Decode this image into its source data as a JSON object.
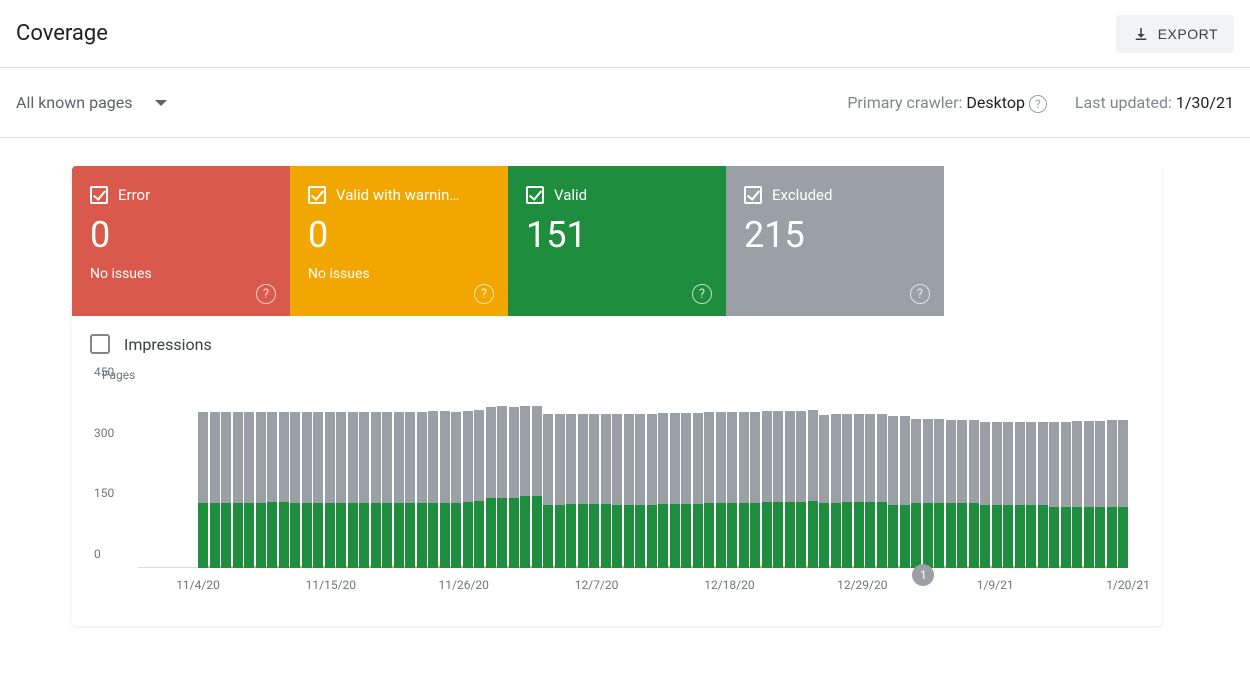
{
  "header": {
    "title": "Coverage",
    "export_label": "EXPORT"
  },
  "filter": {
    "label": "All known pages"
  },
  "meta": {
    "crawler_label": "Primary crawler:",
    "crawler_value": "Desktop",
    "updated_label": "Last updated:",
    "updated_value": "1/30/21"
  },
  "stats": {
    "error": {
      "label": "Error",
      "value": "0",
      "sub": "No issues"
    },
    "warning": {
      "label": "Valid with warnin…",
      "value": "0",
      "sub": "No issues"
    },
    "valid": {
      "label": "Valid",
      "value": "151",
      "sub": ""
    },
    "excluded": {
      "label": "Excluded",
      "value": "215",
      "sub": ""
    }
  },
  "impressions": {
    "label": "Impressions"
  },
  "chart_data": {
    "type": "bar",
    "title": "",
    "ylabel": "Pages",
    "xlabel": "",
    "ylim": [
      0,
      450
    ],
    "yticks": [
      0,
      150,
      300,
      450
    ],
    "categories": [
      "11/4/20",
      "11/15/20",
      "11/26/20",
      "12/7/20",
      "12/18/20",
      "12/29/20",
      "1/9/21",
      "1/20/21"
    ],
    "marker": {
      "label": "1",
      "x_fraction": 0.78
    },
    "series": [
      {
        "name": "Excluded",
        "color": "#9aa0a6",
        "values": [
          225,
          225,
          225,
          225,
          225,
          225,
          223,
          223,
          225,
          225,
          225,
          225,
          225,
          225,
          225,
          225,
          225,
          225,
          225,
          225,
          228,
          228,
          225,
          225,
          225,
          225,
          228,
          225,
          223,
          223,
          225,
          225,
          223,
          223,
          223,
          223,
          225,
          225,
          225,
          225,
          225,
          225,
          225,
          225,
          225,
          225,
          225,
          225,
          225,
          225,
          225,
          225,
          225,
          225,
          218,
          220,
          220,
          220,
          220,
          220,
          220,
          220,
          208,
          208,
          208,
          205,
          205,
          205,
          205,
          205,
          205,
          205,
          205,
          205,
          210,
          210,
          212,
          212,
          212,
          215,
          215
        ]
      },
      {
        "name": "Valid",
        "color": "#1e8e3e",
        "values": [
          160,
          160,
          160,
          160,
          160,
          160,
          162,
          162,
          160,
          160,
          160,
          160,
          160,
          160,
          160,
          160,
          160,
          160,
          160,
          160,
          160,
          160,
          160,
          162,
          165,
          172,
          172,
          172,
          178,
          178,
          155,
          155,
          158,
          158,
          158,
          158,
          155,
          155,
          155,
          155,
          158,
          158,
          158,
          158,
          160,
          160,
          160,
          160,
          160,
          162,
          162,
          162,
          162,
          165,
          160,
          160,
          162,
          162,
          162,
          162,
          155,
          155,
          160,
          160,
          160,
          160,
          160,
          160,
          155,
          155,
          155,
          155,
          155,
          155,
          151,
          151,
          151,
          151,
          151,
          151,
          151
        ]
      },
      {
        "name": "Valid with warnings",
        "color": "#f2a600",
        "values": [
          0,
          0,
          0,
          0,
          0,
          0,
          0,
          0,
          0,
          0,
          0,
          0,
          0,
          0,
          0,
          0,
          0,
          0,
          0,
          0,
          0,
          0,
          0,
          0,
          0,
          0,
          0,
          0,
          0,
          0,
          0,
          0,
          0,
          0,
          0,
          0,
          0,
          0,
          0,
          0,
          0,
          0,
          0,
          0,
          0,
          0,
          0,
          0,
          0,
          0,
          0,
          0,
          0,
          0,
          0,
          0,
          0,
          0,
          0,
          0,
          0,
          0,
          0,
          0,
          0,
          0,
          0,
          0,
          0,
          0,
          0,
          0,
          0,
          0,
          0,
          0,
          0,
          0,
          0,
          0,
          0
        ]
      },
      {
        "name": "Error",
        "color": "#d9594c",
        "values": [
          0,
          0,
          0,
          0,
          0,
          0,
          0,
          0,
          0,
          0,
          0,
          0,
          0,
          0,
          0,
          0,
          0,
          0,
          0,
          0,
          0,
          0,
          0,
          0,
          0,
          0,
          0,
          0,
          0,
          0,
          0,
          0,
          0,
          0,
          0,
          0,
          0,
          0,
          0,
          0,
          0,
          0,
          0,
          0,
          0,
          0,
          0,
          0,
          0,
          0,
          0,
          0,
          0,
          0,
          0,
          0,
          0,
          0,
          0,
          0,
          0,
          0,
          0,
          0,
          0,
          0,
          0,
          0,
          0,
          0,
          0,
          0,
          0,
          0,
          0,
          0,
          0,
          0,
          0,
          0,
          0
        ]
      }
    ]
  }
}
